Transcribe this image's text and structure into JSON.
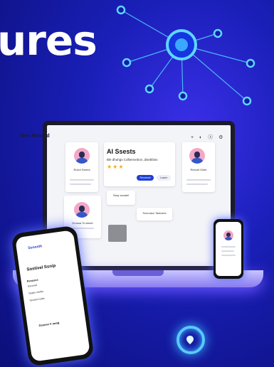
{
  "headline": "ures",
  "laptop": {
    "app_title": "New Resend",
    "toolbar_icons": "+ ◐ ⓢ ⚙",
    "ai_card": {
      "title": "AI Ssests",
      "subtitle": "Ble dhuhgs Colbenvebos ,disebfass",
      "stars": "★★★",
      "primary_button": "Recomnd",
      "secondary_button": "Luwce"
    },
    "profiles": [
      {
        "name": "Rucid Sarma"
      },
      {
        "name": "Resold Oslet"
      },
      {
        "name": "Drnosa To Aeset"
      }
    ],
    "flow_labels": [
      "Sssy ssuaell",
      "Svorcaso Tasioses"
    ]
  },
  "phone_left": {
    "brand": "Sonosth",
    "heading": "Sostivel Ssnip",
    "field_label": "Pesasss",
    "fields": [
      "Ssvorsol",
      "Sasbe rsivtbs",
      "Sensed nsdts"
    ],
    "footer": "Ossese V uoog"
  },
  "colors": {
    "accent_blue": "#1f3fd6",
    "glow": "#3cb8ff",
    "star": "#f2b01e"
  }
}
